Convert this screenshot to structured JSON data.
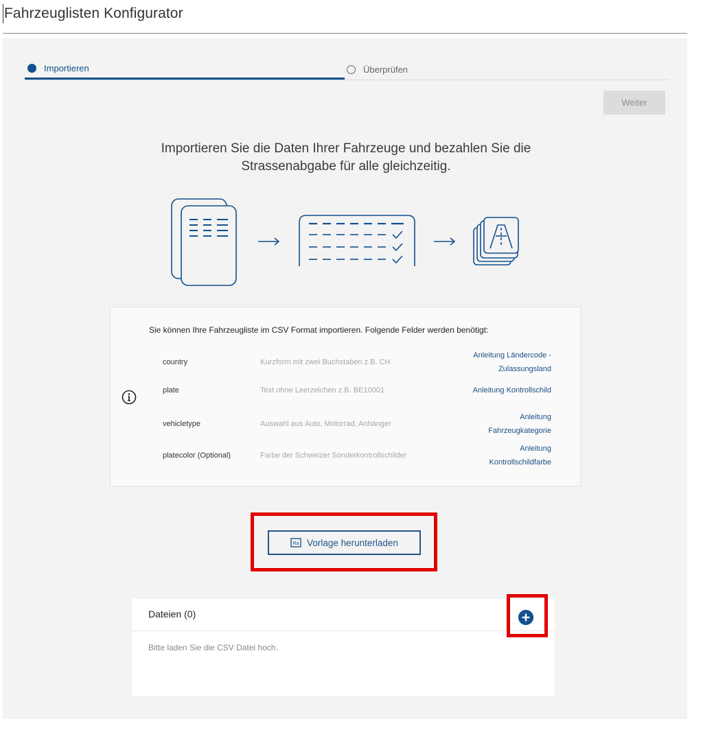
{
  "app": {
    "title": "Fahrzeuglisten Konfigurator"
  },
  "stepper": {
    "steps": [
      {
        "label": "Importieren",
        "state": "active"
      },
      {
        "label": "Überprüfen",
        "state": "inactive"
      }
    ]
  },
  "actions": {
    "next_label": "Weiter"
  },
  "intro": {
    "headline_line1": "Importieren Sie die Daten Ihrer Fahrzeuge und bezahlen Sie die",
    "headline_line2": "Strassenabgabe für alle gleichzeitig."
  },
  "info": {
    "intro": "Sie können Ihre Fahrzeugliste im CSV Format importieren. Folgende Felder werden benötigt:",
    "fields": [
      {
        "name": "country",
        "description": "Kurzform mit zwei Buchstaben z.B. CH",
        "link_line1": "Anleitung Ländercode -",
        "link_line2": "Zulassungsland"
      },
      {
        "name": "plate",
        "description": "Text ohne Leerzeichen z.B. BE10001",
        "link_line1": "Anleitung Kontrollschild",
        "link_line2": ""
      },
      {
        "name": "vehicletype",
        "description": "Auswahl aus Auto, Motorrad, Anhänger",
        "link_line1": "Anleitung",
        "link_line2": "Fahrzeugkategorie"
      },
      {
        "name": "platecolor (Optional)",
        "description": "Farbe der Schweizer Sonderkontrollschilder",
        "link_line1": "Anleitung",
        "link_line2": "Kontrollschildfarbe"
      }
    ]
  },
  "download": {
    "label": "Vorlage herunterladen",
    "icon": "template-file-icon"
  },
  "files": {
    "title": "Dateien (0)",
    "empty_message": "Bitte laden Sie die CSV Datei hoch.",
    "add_icon": "plus-circle-icon"
  },
  "colors": {
    "primary": "#12508e",
    "highlight": "#e00000",
    "panel": "#f3f3f3"
  }
}
